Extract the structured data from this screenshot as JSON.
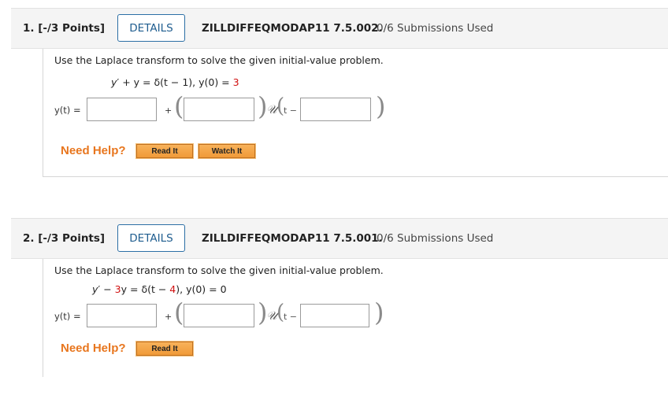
{
  "questions": [
    {
      "number_points": "1. [-/3 Points]",
      "details_label": "DETAILS",
      "code": "ZILLDIFFEQMODAP11 7.5.002.",
      "submissions": "0/6 Submissions Used",
      "prompt": "Use the Laplace transform to solve the given initial-value problem.",
      "eq_y": "y",
      "eq_op": "′ + y = δ(t − 1), ",
      "eq_init": "y(0) = ",
      "eq_init_value": "3",
      "answer_label": "y(t) =",
      "plus": "+",
      "unit_step": "𝒰",
      "t_minus": "t −",
      "need_help": "Need Help?",
      "read_it": "Read It",
      "watch_it": "Watch It"
    },
    {
      "number_points": "2. [-/3 Points]",
      "details_label": "DETAILS",
      "code": "ZILLDIFFEQMODAP11 7.5.001.",
      "submissions": "0/6 Submissions Used",
      "prompt": "Use the Laplace transform to solve the given initial-value problem.",
      "eq_y": "y",
      "eq_op_a": "′ − ",
      "eq_coef": "3",
      "eq_op_b": "y = δ(t − ",
      "eq_shift": "4",
      "eq_op_c": "), ",
      "eq_init": "y(0) = 0",
      "answer_label": "y(t) =",
      "plus": "+",
      "unit_step": "𝒰",
      "t_minus": "t −",
      "need_help": "Need Help?",
      "read_it": "Read It"
    }
  ]
}
